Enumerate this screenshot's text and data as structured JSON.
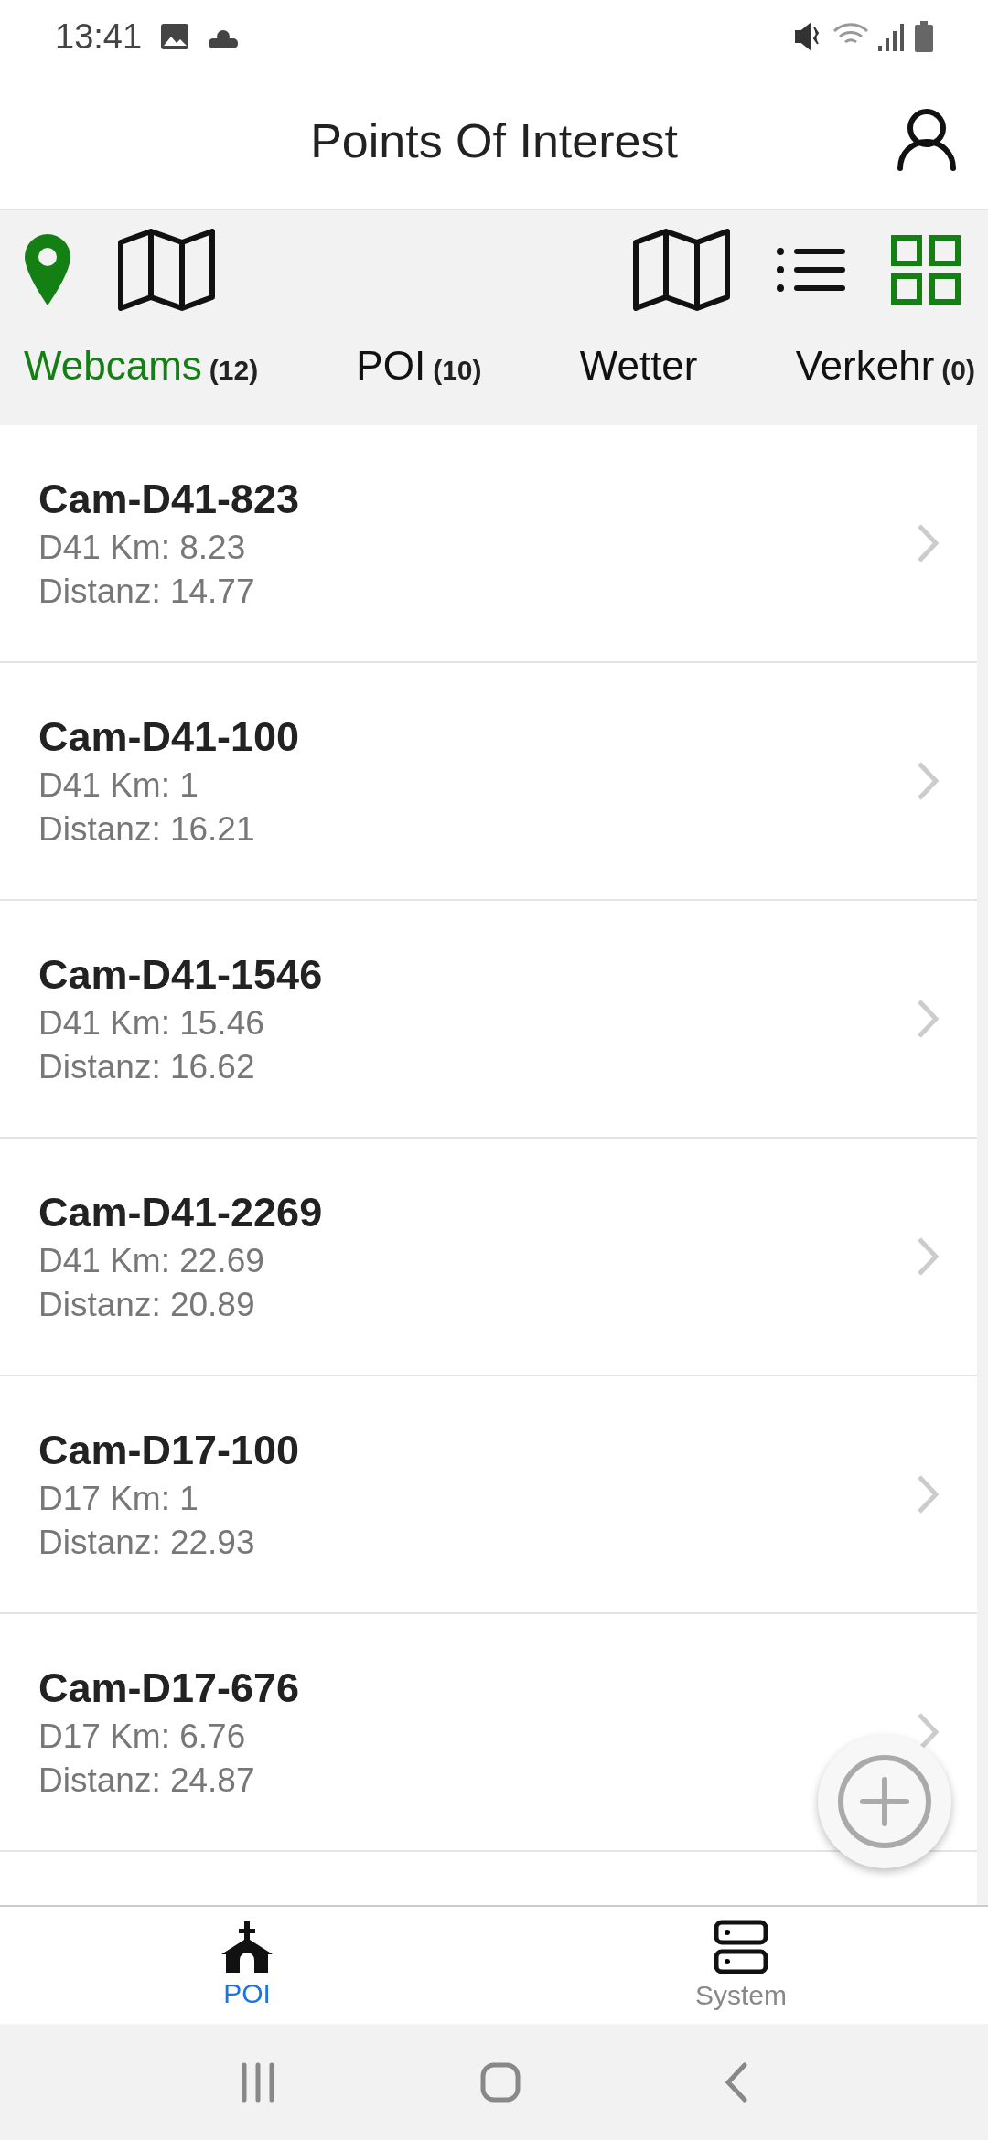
{
  "status_bar": {
    "time": "13:41"
  },
  "header": {
    "title": "Points Of Interest"
  },
  "toolbar_icons": [
    {
      "kind": "pin",
      "selected": true
    },
    {
      "kind": "map",
      "selected": false
    },
    {
      "kind": "map",
      "selected": false
    },
    {
      "kind": "list",
      "selected": false
    },
    {
      "kind": "grid",
      "selected": true
    }
  ],
  "tabs": [
    {
      "label": "Webcams",
      "count": "(12)",
      "selected": true
    },
    {
      "label": "POI",
      "count": "(10)",
      "selected": false
    },
    {
      "label": "Wetter",
      "selected": false
    },
    {
      "label": "Verkehr",
      "count": "(0)",
      "selected": false
    }
  ],
  "items": [
    {
      "title": "Cam-D41-823",
      "km": "D41 Km: 8.23",
      "distance": "Distanz: 14.77"
    },
    {
      "title": "Cam-D41-100",
      "km": "D41 Km: 1",
      "distance": "Distanz: 16.21"
    },
    {
      "title": "Cam-D41-1546",
      "km": "D41 Km: 15.46",
      "distance": "Distanz: 16.62"
    },
    {
      "title": "Cam-D41-2269",
      "km": "D41 Km: 22.69",
      "distance": "Distanz: 20.89"
    },
    {
      "title": "Cam-D17-100",
      "km": "D17 Km: 1",
      "distance": "Distanz: 22.93"
    },
    {
      "title": "Cam-D17-676",
      "km": "D17 Km: 6.76",
      "distance": "Distanz: 24.87"
    }
  ],
  "bottom_nav": [
    {
      "kind": "church",
      "label": "POI",
      "selected": true
    },
    {
      "kind": "server",
      "label": "System",
      "selected": false
    }
  ]
}
